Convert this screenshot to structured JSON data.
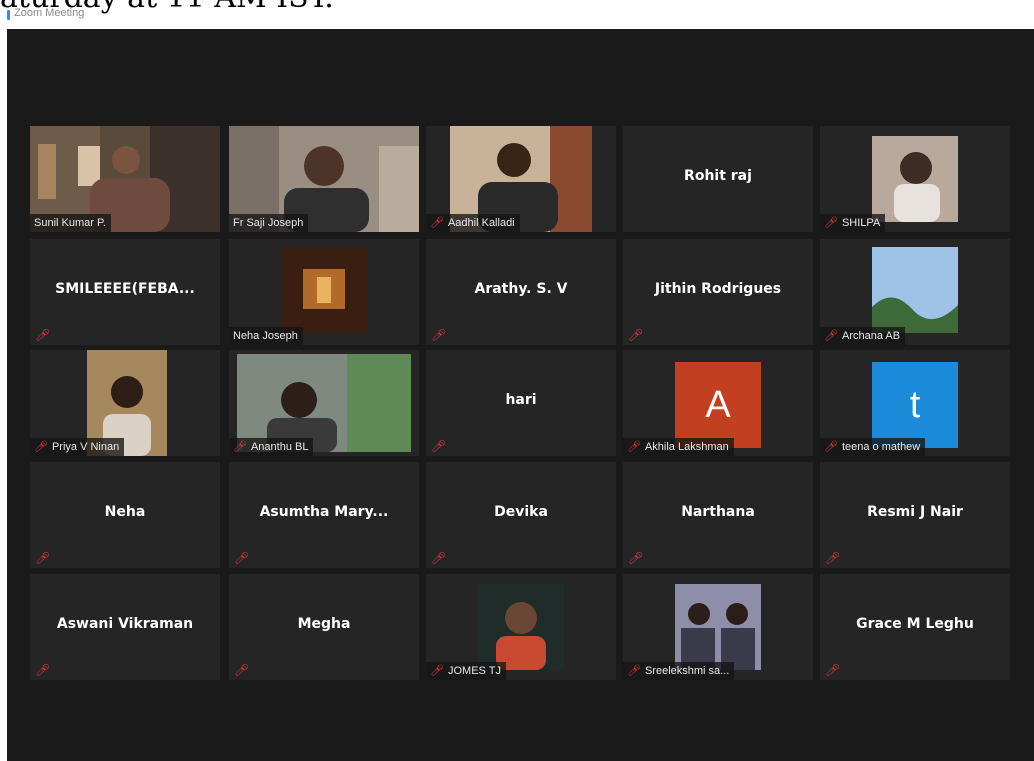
{
  "page": {
    "doc_text": "aturday at 11 AM IST.",
    "window_title": "Zoom Meeting"
  },
  "colors": {
    "background": "#1a1a1a",
    "tile": "#252525",
    "active_speaker_border": "#cbd950",
    "muted_icon": "#e0393b",
    "avatar_A": "#c2401f",
    "avatar_t": "#1a8ad9"
  },
  "participants": [
    {
      "name": "Sunil Kumar P.",
      "mode": "video",
      "muted": false,
      "active": true
    },
    {
      "name": "Fr Saji Joseph",
      "mode": "video",
      "muted": false
    },
    {
      "name": "Aadhil Kalladi",
      "mode": "video",
      "muted": true
    },
    {
      "name": "Rohit raj",
      "mode": "name",
      "muted": false
    },
    {
      "name": "SHILPA",
      "mode": "photo",
      "muted": true
    },
    {
      "name": "SMILEEEE(FEBA...",
      "mode": "name",
      "muted": true
    },
    {
      "name": "Neha Joseph",
      "mode": "photo",
      "muted": false
    },
    {
      "name": "Arathy. S. V",
      "mode": "name",
      "muted": true
    },
    {
      "name": "Jithin Rodrigues",
      "mode": "name",
      "muted": true
    },
    {
      "name": "Archana AB",
      "mode": "photo",
      "muted": true
    },
    {
      "name": "Priya V Ninan",
      "mode": "photo",
      "muted": true
    },
    {
      "name": "Ananthu BL",
      "mode": "photo",
      "muted": true
    },
    {
      "name": "hari",
      "mode": "name",
      "muted": true
    },
    {
      "name": "Akhila Lakshman",
      "mode": "avatar",
      "avatar_letter": "A",
      "muted": true
    },
    {
      "name": "teena o mathew",
      "mode": "avatar",
      "avatar_letter": "t",
      "muted": true
    },
    {
      "name": "Neha",
      "mode": "name",
      "muted": true
    },
    {
      "name": "Asumtha Mary...",
      "mode": "name",
      "muted": true
    },
    {
      "name": "Devika",
      "mode": "name",
      "muted": true
    },
    {
      "name": "Narthana",
      "mode": "name",
      "muted": true
    },
    {
      "name": "Resmi J Nair",
      "mode": "name",
      "muted": true
    },
    {
      "name": "Aswani Vikraman",
      "mode": "name",
      "muted": true
    },
    {
      "name": "Megha",
      "mode": "name",
      "muted": true
    },
    {
      "name": "JOMES TJ",
      "mode": "photo",
      "muted": true
    },
    {
      "name": "Sreelekshmi sa...",
      "mode": "photo",
      "muted": true
    },
    {
      "name": "Grace M Leghu",
      "mode": "name",
      "muted": true
    }
  ]
}
